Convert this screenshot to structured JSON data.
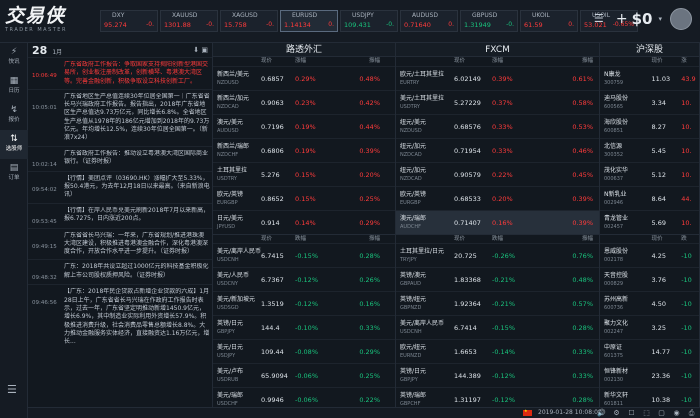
{
  "app": {
    "logo_main": "交易侠",
    "logo_sub": "TRADER MASTER",
    "balance": "$0",
    "plus": "+",
    "caret": "▾"
  },
  "colors": {
    "up": "#ff3b3b",
    "down": "#19c37d",
    "bg": "#0f141b",
    "panel": "#12181f"
  },
  "tickers": [
    {
      "name": "DXY",
      "value": "95.274",
      "change": "-0.",
      "dir": "up",
      "active": false
    },
    {
      "name": "XAUUSD",
      "value": "1301.88",
      "change": "-0.",
      "dir": "up",
      "active": false
    },
    {
      "name": "XAGUSD",
      "value": "15.758",
      "change": "-0.",
      "dir": "up",
      "active": false
    },
    {
      "name": "EURUSD",
      "value": "1.14134",
      "change": "0.",
      "dir": "up",
      "active": true
    },
    {
      "name": "USDJPY",
      "value": "109.431",
      "change": "-0.",
      "dir": "down",
      "active": false
    },
    {
      "name": "AUDUSD",
      "value": "0.71640",
      "change": "0.",
      "dir": "up",
      "active": false
    },
    {
      "name": "GBPUSD",
      "value": "1.31949",
      "change": "-0.",
      "dir": "down",
      "active": false
    },
    {
      "name": "UKOIL",
      "value": "61.59",
      "change": "0.",
      "dir": "up",
      "active": false
    },
    {
      "name": "USOIL",
      "value": "53.021",
      "change": "-0.65%",
      "dir": "up",
      "active": false
    }
  ],
  "nav": [
    {
      "icon": "⚡",
      "label": "快讯",
      "active": false
    },
    {
      "icon": "▦",
      "label": "日历",
      "active": false
    },
    {
      "icon": "↯",
      "label": "报价",
      "active": false
    },
    {
      "icon": "⇅",
      "label": "选股师",
      "active": true
    },
    {
      "icon": "▤",
      "label": "订单",
      "active": false
    }
  ],
  "news": {
    "day": "28",
    "month": "1月",
    "tools": "⬇  ▣",
    "items": [
      {
        "time": "10:06:49",
        "hl": true,
        "text": "广东省政府工作报告：争取国家支持揭阳创新型港国交易所，创业板注册制改革，创新横琴、粤港澳大湾区等。完善金融创新，积极争取设立科技创新工厂。"
      },
      {
        "time": "10:05:01",
        "hl": false,
        "text": "广东省地区生产总值连续30年位居全国第一｜广东省省长马兴瑞政府工作报告。报告指出，2018年广东省地区生产总值达9.73万亿元，同比增长6.8%。全省地区生产总值从1978年的186亿元增加到2018年的9.73万亿元。年均增长12.5%，连续30年位居全国第一。（新浪7x24）"
      },
      {
        "time": "10:02:14",
        "hl": false,
        "text": "广东省政府工作报告：推动设立粤港澳大湾区国际商业银行。（证券时报）"
      },
      {
        "time": "09:54:02",
        "hl": false,
        "text": "【行情】美团点评（03690.HK）涨幅扩大至5.33%，报50.4港元，为去年12月18日以来最高。（来自新浪电讯）"
      },
      {
        "time": "09:53:45",
        "hl": false,
        "text": "【行情】在岸人民币兑美元刷新2018年7月以来新高，报6.7275，日内涨近200点。"
      },
      {
        "time": "09:49:15",
        "hl": false,
        "text": "广东省省长马兴瑞：一年来，广东省规划/推进港珠澳大湾区建设，积极推进粤港澳金融合作，深化粤港澳深度合作，开放合作水平进一步提升。（证券时报）"
      },
      {
        "time": "09:48:32",
        "hl": false,
        "text": "广东：2018年共设立超过1000亿元的科技基金积极化解上市公司股权质押风险。（证券时报）"
      },
      {
        "time": "09:46:56",
        "hl": false,
        "text": "【广东：2018年民企贷款占新增企业贷款的六成】1月28日上午，广东省省长马兴瑞在作政府工作报告时表示，过去一年，广东省坚定明推动新增1450.9亿元，增长6.9%，其中制造业实际利用外资增长57.9%。积极推进消费升级，社会消费品零售总额增长8.8%。大力推动金融服务实体经济，直接融资达1.16万亿元，增长..."
      }
    ]
  },
  "quotes": {
    "panel1": {
      "title": "路透外汇",
      "headers": [
        "",
        "现价",
        "涨幅",
        "",
        "振幅"
      ],
      "rows": [
        {
          "name": "新西兰/美元",
          "code": "NZDUSD",
          "price": "0.6857",
          "chg": "0.29%",
          "amp": "0.48%",
          "dir": "up"
        },
        {
          "name": "新西兰/加元",
          "code": "NZDCAD",
          "price": "0.9063",
          "chg": "0.23%",
          "amp": "0.42%",
          "dir": "up"
        },
        {
          "name": "澳元/美元",
          "code": "AUDUSD",
          "price": "0.7196",
          "chg": "0.19%",
          "amp": "0.44%",
          "dir": "up"
        },
        {
          "name": "新西兰/瑞郎",
          "code": "NZDCHF",
          "price": "0.6806",
          "chg": "0.19%",
          "amp": "0.39%",
          "dir": "up"
        },
        {
          "name": "土耳其里拉",
          "code": "USDTRY",
          "price": "5.276",
          "chg": "0.15%",
          "amp": "0.20%",
          "dir": "up"
        },
        {
          "name": "欧元/英镑",
          "code": "EURGBP",
          "price": "0.8652",
          "chg": "0.15%",
          "amp": "0.25%",
          "dir": "up"
        },
        {
          "name": "日元/美元",
          "code": "JPYUSD",
          "price": "0.914",
          "chg": "0.14%",
          "amp": "0.29%",
          "dir": "up"
        }
      ],
      "headers2": [
        "",
        "现价",
        "跌幅",
        "",
        "振幅"
      ],
      "rows2": [
        {
          "name": "美元/离岸人民币",
          "code": "USDCNH",
          "price": "6.7415",
          "chg": "-0.15%",
          "amp": "0.28%",
          "dir": "down"
        },
        {
          "name": "美元/人民币",
          "code": "USDCNY",
          "price": "6.7367",
          "chg": "-0.12%",
          "amp": "0.26%",
          "dir": "down"
        },
        {
          "name": "美元/新加坡元",
          "code": "USDSGD",
          "price": "1.3519",
          "chg": "-0.12%",
          "amp": "0.16%",
          "dir": "down"
        },
        {
          "name": "英镑/日元",
          "code": "GBPJPY",
          "price": "144.4",
          "chg": "-0.10%",
          "amp": "0.33%",
          "dir": "down"
        },
        {
          "name": "美元/日元",
          "code": "USDJPY",
          "price": "109.44",
          "chg": "-0.08%",
          "amp": "0.29%",
          "dir": "down"
        },
        {
          "name": "美元/卢布",
          "code": "USDRUB",
          "price": "65.9094",
          "chg": "-0.06%",
          "amp": "0.25%",
          "dir": "down"
        },
        {
          "name": "美元/瑞郎",
          "code": "USDCHF",
          "price": "0.9946",
          "chg": "-0.06%",
          "amp": "0.22%",
          "dir": "down"
        }
      ]
    },
    "panel2": {
      "title": "FXCM",
      "headers": [
        "",
        "现价",
        "涨幅",
        "",
        "振幅"
      ],
      "rows": [
        {
          "name": "欧元/土耳其里拉",
          "code": "EURTRY",
          "price": "6.02149",
          "chg": "0.39%",
          "amp": "0.61%",
          "dir": "up"
        },
        {
          "name": "美元/土耳其里拉",
          "code": "USDTRY",
          "price": "5.27229",
          "chg": "0.37%",
          "amp": "0.58%",
          "dir": "up"
        },
        {
          "name": "纽元/美元",
          "code": "NZDUSD",
          "price": "0.68576",
          "chg": "0.33%",
          "amp": "0.53%",
          "dir": "up"
        },
        {
          "name": "纽元/加元",
          "code": "NZDCAD",
          "price": "0.71954",
          "chg": "0.33%",
          "amp": "0.46%",
          "dir": "up"
        },
        {
          "name": "纽元/加元",
          "code": "NZDCAD",
          "price": "0.90579",
          "chg": "0.22%",
          "amp": "0.45%",
          "dir": "up"
        },
        {
          "name": "欧元/英镑",
          "code": "EURGBP",
          "price": "0.68533",
          "chg": "0.20%",
          "amp": "0.39%",
          "dir": "up"
        },
        {
          "name": "澳元/瑞郎",
          "code": "AUDCHF",
          "price": "0.71407",
          "chg": "0.16%",
          "amp": "0.39%",
          "dir": "up",
          "sel": true
        }
      ],
      "headers2": [
        "",
        "现价",
        "跌幅",
        "",
        "振幅"
      ],
      "rows2": [
        {
          "name": "土耳其里拉/日元",
          "code": "TRYJPY",
          "price": "20.725",
          "chg": "-0.26%",
          "amp": "0.76%",
          "dir": "down"
        },
        {
          "name": "英镑/澳元",
          "code": "GBPAUD",
          "price": "1.83368",
          "chg": "-0.21%",
          "amp": "0.48%",
          "dir": "down"
        },
        {
          "name": "英镑/纽元",
          "code": "GBPNZD",
          "price": "1.92364",
          "chg": "-0.21%",
          "amp": "0.57%",
          "dir": "down"
        },
        {
          "name": "美元/离岸人民币",
          "code": "USDCNH",
          "price": "6.7414",
          "chg": "-0.15%",
          "amp": "0.28%",
          "dir": "down"
        },
        {
          "name": "欧元/纽元",
          "code": "EURNZD",
          "price": "1.6653",
          "chg": "-0.14%",
          "amp": "0.33%",
          "dir": "down"
        },
        {
          "name": "英镑/日元",
          "code": "GBPJPY",
          "price": "144.389",
          "chg": "-0.12%",
          "amp": "0.33%",
          "dir": "down"
        },
        {
          "name": "英镑/瑞郎",
          "code": "GBPCHF",
          "price": "1.31197",
          "chg": "-0.12%",
          "amp": "0.28%",
          "dir": "down"
        }
      ]
    },
    "panel3": {
      "title": "沪深股",
      "headers": [
        "",
        "现价",
        "涨"
      ],
      "rows": [
        {
          "name": "N康龙",
          "code": "300759",
          "price": "11.03",
          "chg": "43.9",
          "dir": "up"
        },
        {
          "name": "迪马股份",
          "code": "600565",
          "price": "3.34",
          "chg": "10.",
          "dir": "up"
        },
        {
          "name": "海欣股份",
          "code": "600851",
          "price": "8.27",
          "chg": "10.",
          "dir": "up"
        },
        {
          "name": "北信源",
          "code": "300352",
          "price": "5.45",
          "chg": "10.",
          "dir": "up"
        },
        {
          "name": "茂化实华",
          "code": "000637",
          "price": "5.12",
          "chg": "10.",
          "dir": "up"
        },
        {
          "name": "N新乳业",
          "code": "002946",
          "price": "8.64",
          "chg": "44.",
          "dir": "up"
        },
        {
          "name": "青龙管业",
          "code": "002457",
          "price": "5.69",
          "chg": "10.",
          "dir": "up"
        }
      ],
      "headers2": [
        "",
        "现价",
        "跌"
      ],
      "rows2": [
        {
          "name": "恩威股份",
          "code": "002178",
          "price": "4.25",
          "chg": "-10",
          "dir": "down"
        },
        {
          "name": "天音控股",
          "code": "000829",
          "price": "3.76",
          "chg": "-10",
          "dir": "down"
        },
        {
          "name": "苏州高新",
          "code": "600736",
          "price": "4.50",
          "chg": "-10",
          "dir": "down"
        },
        {
          "name": "聚力文化",
          "code": "002247",
          "price": "3.25",
          "chg": "-10",
          "dir": "down"
        },
        {
          "name": "中原证",
          "code": "601375",
          "price": "14.77",
          "chg": "-10",
          "dir": "down"
        },
        {
          "name": "恒锋新材",
          "code": "002130",
          "price": "23.36",
          "chg": "-10",
          "dir": "down"
        },
        {
          "name": "新华文轩",
          "code": "601811",
          "price": "10.38",
          "chg": "-10",
          "dir": "down"
        }
      ]
    }
  },
  "status": {
    "datetime": "2019-01-28 10:08:08",
    "icons": [
      "🔊",
      "⚙",
      "☐",
      "⬚",
      "▢",
      "◉",
      "⎙",
      "⊞"
    ]
  }
}
